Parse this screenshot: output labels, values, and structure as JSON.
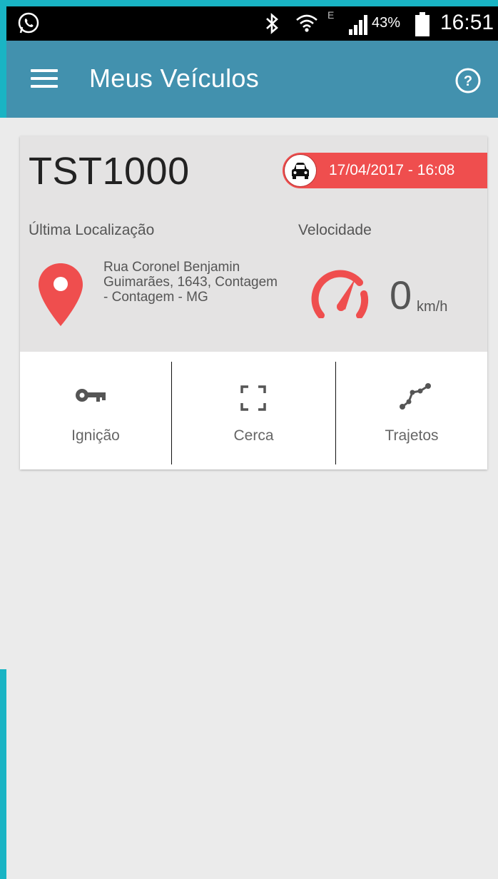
{
  "status_bar": {
    "battery_percent": "43%",
    "time": "16:51",
    "network_label": "E",
    "icons": [
      "whatsapp-icon",
      "bluetooth-icon",
      "wifi-icon",
      "signal-icon",
      "battery-icon"
    ]
  },
  "app_bar": {
    "title": "Meus Veículos",
    "color": "#4291ae",
    "icons": [
      "menu-icon",
      "help-icon"
    ]
  },
  "vehicle": {
    "plate": "TST1000",
    "last_update": "17/04/2017 - 16:08",
    "badge_color": "#ef4e4e",
    "location_label": "Última Localização",
    "address": "Rua Coronel Benjamin Guimarães, 1643, Contagem - Contagem - MG",
    "speed_label": "Velocidade",
    "speed_value": "0",
    "speed_unit": "km/h",
    "accent_color": "#ef4e4e"
  },
  "actions": [
    {
      "label": "Ignição",
      "icon": "key-icon"
    },
    {
      "label": "Cerca",
      "icon": "fence-icon"
    },
    {
      "label": "Trajetos",
      "icon": "route-icon"
    }
  ]
}
